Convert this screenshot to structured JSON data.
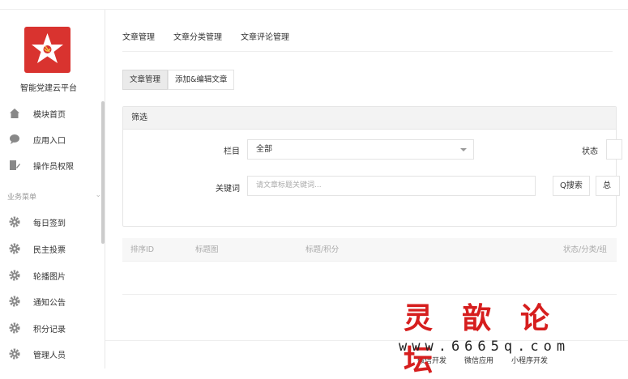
{
  "brand": {
    "name": "智能党建云平台"
  },
  "sidebar": {
    "top_items": [
      {
        "label": "模块首页",
        "icon": "home-icon"
      },
      {
        "label": "应用入口",
        "icon": "chat-icon"
      },
      {
        "label": "操作员权限",
        "icon": "user-edit-icon"
      }
    ],
    "section_title": "业务菜单",
    "biz_items": [
      {
        "label": "每日签到",
        "icon": "gear-icon"
      },
      {
        "label": "民主投票",
        "icon": "gear-icon"
      },
      {
        "label": "轮播图片",
        "icon": "gear-icon"
      },
      {
        "label": "通知公告",
        "icon": "gear-icon"
      },
      {
        "label": "积分记录",
        "icon": "gear-icon"
      },
      {
        "label": "管理人员",
        "icon": "gear-icon"
      }
    ]
  },
  "tabs": [
    "文章管理",
    "文章分类管理",
    "文章评论管理"
  ],
  "subtabs": [
    "文章管理",
    "添加&编辑文章"
  ],
  "filter": {
    "title": "筛选",
    "column_label": "栏目",
    "column_value": "全部",
    "status_label": "状态",
    "keyword_label": "关键词",
    "keyword_placeholder": "请文章标题关键词...",
    "search_button": "Q搜索",
    "extra_button": "总"
  },
  "table": {
    "headers": [
      "排序ID",
      "标题图",
      "标题/积分",
      "状态/分类/组"
    ]
  },
  "footer": {
    "links": [
      "微信开发",
      "微信应用",
      "小程序开发"
    ]
  },
  "watermark": {
    "cn": "灵歆论坛",
    "url": "www.6665q.com"
  },
  "colors": {
    "brand_red": "#d9332f",
    "watermark_red": "#d61e1e"
  }
}
